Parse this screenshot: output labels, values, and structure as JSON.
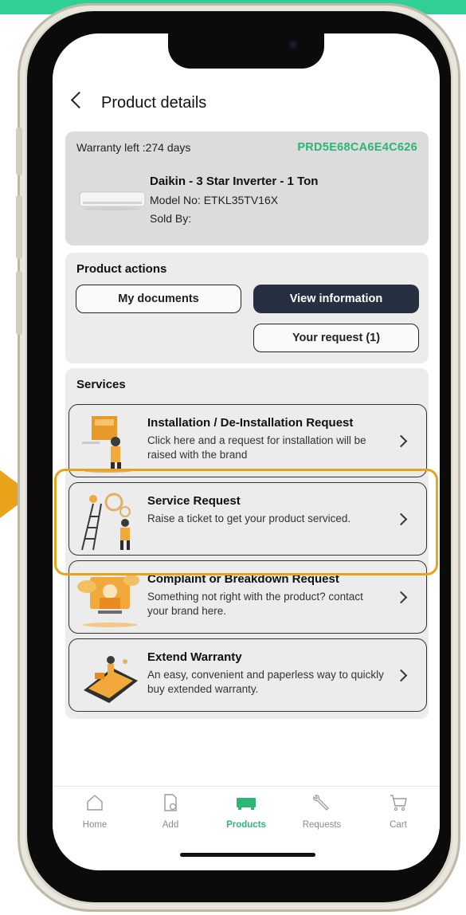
{
  "header": {
    "title": "Product details"
  },
  "warranty": {
    "label": "Warranty left :274 days",
    "product_code": "PRD5E68CA6E4C626"
  },
  "product": {
    "name": "Daikin - 3 Star Inverter - 1 Ton",
    "model": "Model No: ETKL35TV16X",
    "sold_by": "Sold By:"
  },
  "actions": {
    "title": "Product actions",
    "my_documents": "My documents",
    "view_information": "View information",
    "your_request": "Your request (1)"
  },
  "services": {
    "title": "Services",
    "items": [
      {
        "title": "Installation / De-Installation Request",
        "desc": "Click here and a request for installation will be raised with the brand",
        "icon": "installation-illustration"
      },
      {
        "title": "Service Request",
        "desc": "Raise a ticket to get your product serviced.",
        "icon": "technician-ladder-illustration"
      },
      {
        "title": "Complaint or Breakdown Request",
        "desc": "Something not right with the product? contact your brand here.",
        "icon": "support-agent-illustration"
      },
      {
        "title": "Extend Warranty",
        "desc": "An easy, convenient and paperless way to quickly buy extended warranty.",
        "icon": "warranty-illustration"
      }
    ]
  },
  "nav": {
    "items": [
      {
        "label": "Home",
        "icon": "home-icon",
        "active": false
      },
      {
        "label": "Add",
        "icon": "add-document-icon",
        "active": false
      },
      {
        "label": "Products",
        "icon": "products-icon",
        "active": true
      },
      {
        "label": "Requests",
        "icon": "wrench-icon",
        "active": false
      },
      {
        "label": "Cart",
        "icon": "cart-icon",
        "active": false
      }
    ]
  },
  "colors": {
    "accent_green": "#2bb673",
    "highlight_orange": "#e9a31a",
    "dark_button": "#263041"
  }
}
